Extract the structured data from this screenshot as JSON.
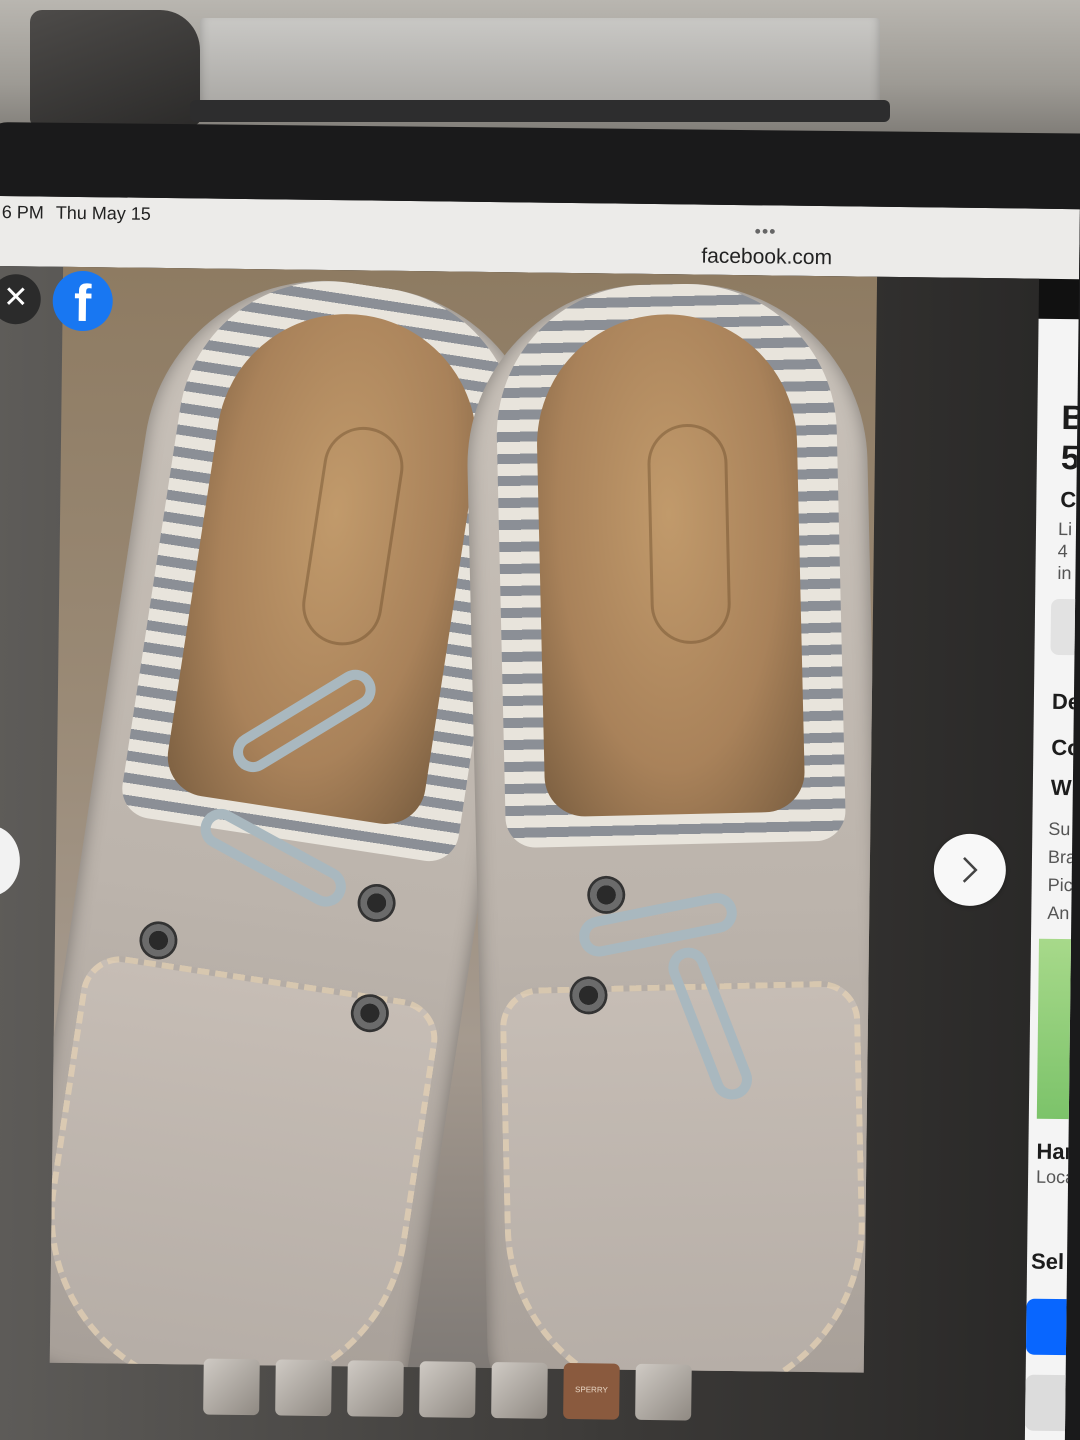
{
  "status_bar": {
    "time": "6 PM",
    "date": "Thu May 15",
    "dots": "•••",
    "url": "facebook.com"
  },
  "viewer": {
    "close_glyph": "✕",
    "app_logo_glyph": "f",
    "next_glyph": "chevron-right-icon",
    "thumbnail_brand_label": "SPERRY"
  },
  "listing_panel_fragments": {
    "title_lines": [
      "B",
      "5"
    ],
    "condition": "C",
    "meta_lines": [
      "Li",
      "4",
      "in"
    ],
    "details_heading": "De",
    "condition_label": "Co",
    "size_label": "W",
    "description_lines": [
      "Su",
      "Bra",
      "Pic",
      "An"
    ],
    "location_name": "Har",
    "location_sub": "Loca",
    "seller_heading": "Sel"
  },
  "colors": {
    "facebook_blue": "#1877f2",
    "primary_button": "#0866ff"
  }
}
